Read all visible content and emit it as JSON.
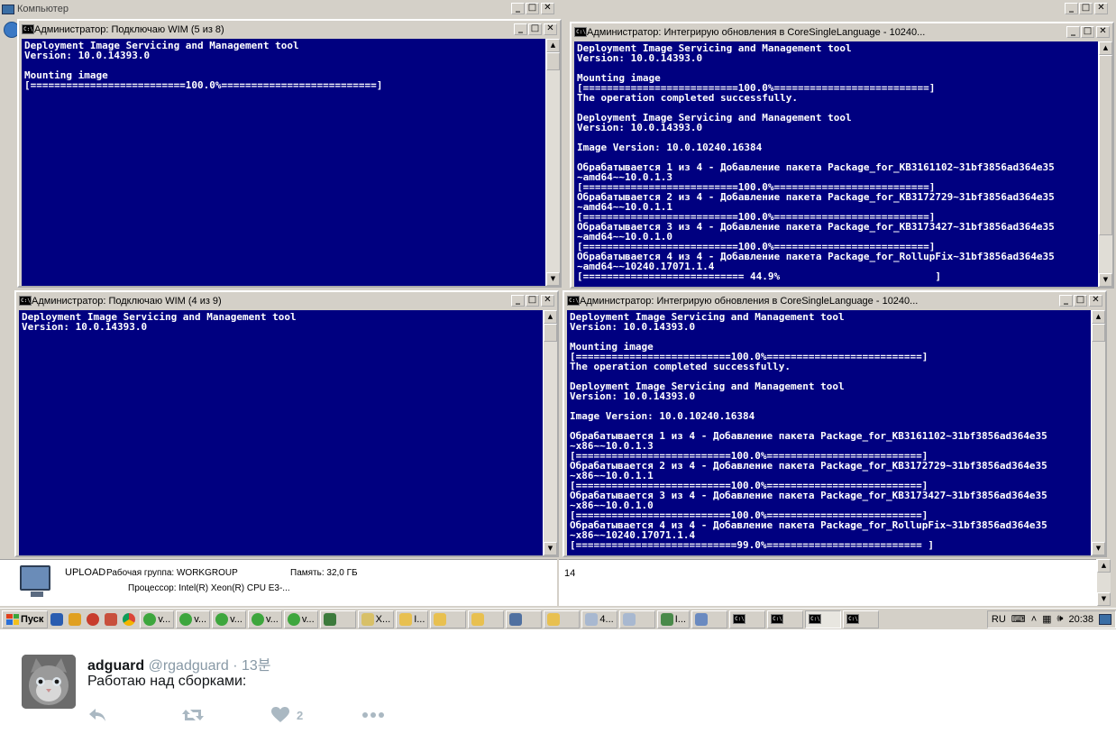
{
  "explorer": {
    "title": "Компьютер"
  },
  "windows": {
    "top_left": {
      "title": "Администратор: Подключаю WIM (5 из 8)",
      "lines": [
        "Deployment Image Servicing and Management tool",
        "Version: 10.0.14393.0",
        "",
        "Mounting image",
        "[==========================100.0%==========================]"
      ]
    },
    "top_right": {
      "title": "Администратор: Интегрирую обновления в CoreSingleLanguage - 10240...",
      "lines": [
        "Deployment Image Servicing and Management tool",
        "Version: 10.0.14393.0",
        "",
        "Mounting image",
        "[==========================100.0%==========================]",
        "The operation completed successfully.",
        "",
        "Deployment Image Servicing and Management tool",
        "Version: 10.0.14393.0",
        "",
        "Image Version: 10.0.10240.16384",
        "",
        "Обрабатывается 1 из 4 - Добавление пакета Package_for_KB3161102~31bf3856ad364e35",
        "~amd64~~10.0.1.3",
        "[==========================100.0%==========================]",
        "Обрабатывается 2 из 4 - Добавление пакета Package_for_KB3172729~31bf3856ad364e35",
        "~amd64~~10.0.1.1",
        "[==========================100.0%==========================]",
        "Обрабатывается 3 из 4 - Добавление пакета Package_for_KB3173427~31bf3856ad364e35",
        "~amd64~~10.0.1.0",
        "[==========================100.0%==========================]",
        "Обрабатывается 4 из 4 - Добавление пакета Package_for_RollupFix~31bf3856ad364e35",
        "~amd64~~10240.17071.1.4",
        "[=========================== 44.9%                          ]"
      ]
    },
    "bottom_left": {
      "title": "Администратор: Подключаю WIM (4 из 9)",
      "lines": [
        "Deployment Image Servicing and Management tool",
        "Version: 10.0.14393.0"
      ]
    },
    "bottom_right": {
      "title": "Администратор: Интегрирую обновления в CoreSingleLanguage - 10240...",
      "lines": [
        "Deployment Image Servicing and Management tool",
        "Version: 10.0.14393.0",
        "",
        "Mounting image",
        "[==========================100.0%==========================]",
        "The operation completed successfully.",
        "",
        "Deployment Image Servicing and Management tool",
        "Version: 10.0.14393.0",
        "",
        "Image Version: 10.0.10240.16384",
        "",
        "Обрабатывается 1 из 4 - Добавление пакета Package_for_KB3161102~31bf3856ad364e35",
        "~x86~~10.0.1.3",
        "[==========================100.0%==========================]",
        "Обрабатывается 2 из 4 - Добавление пакета Package_for_KB3172729~31bf3856ad364e35",
        "~x86~~10.0.1.1",
        "[==========================100.0%==========================]",
        "Обрабатывается 3 из 4 - Добавление пакета Package_for_KB3173427~31bf3856ad364e35",
        "~x86~~10.0.1.0",
        "[==========================100.0%==========================]",
        "Обрабатывается 4 из 4 - Добавление пакета Package_for_RollupFix~31bf3856ad364e35",
        "~x86~~10240.17071.1.4",
        "[===========================99.0%========================== ]"
      ]
    }
  },
  "details_pane": {
    "computer_name": "UPLOAD",
    "workgroup": "Рабочая группа: WORKGROUP",
    "memory": "Память: 32,0 ГБ",
    "processor": "Процессор: Intel(R) Xeon(R) CPU E3-...",
    "right_value": "14"
  },
  "taskbar": {
    "start_label": "Пуск",
    "buttons": [
      "v...",
      "v...",
      "v...",
      "v...",
      "v...",
      "",
      "X...",
      "I...",
      "",
      "",
      "",
      "",
      "4...",
      "",
      "I...",
      "",
      "",
      "",
      "",
      ""
    ],
    "language": "RU",
    "clock": "20:38"
  },
  "tweet": {
    "name": "adguard",
    "handle": "@rgadguard",
    "time": "· 13분",
    "text": "Работаю над сборками:",
    "like_count": "2"
  }
}
